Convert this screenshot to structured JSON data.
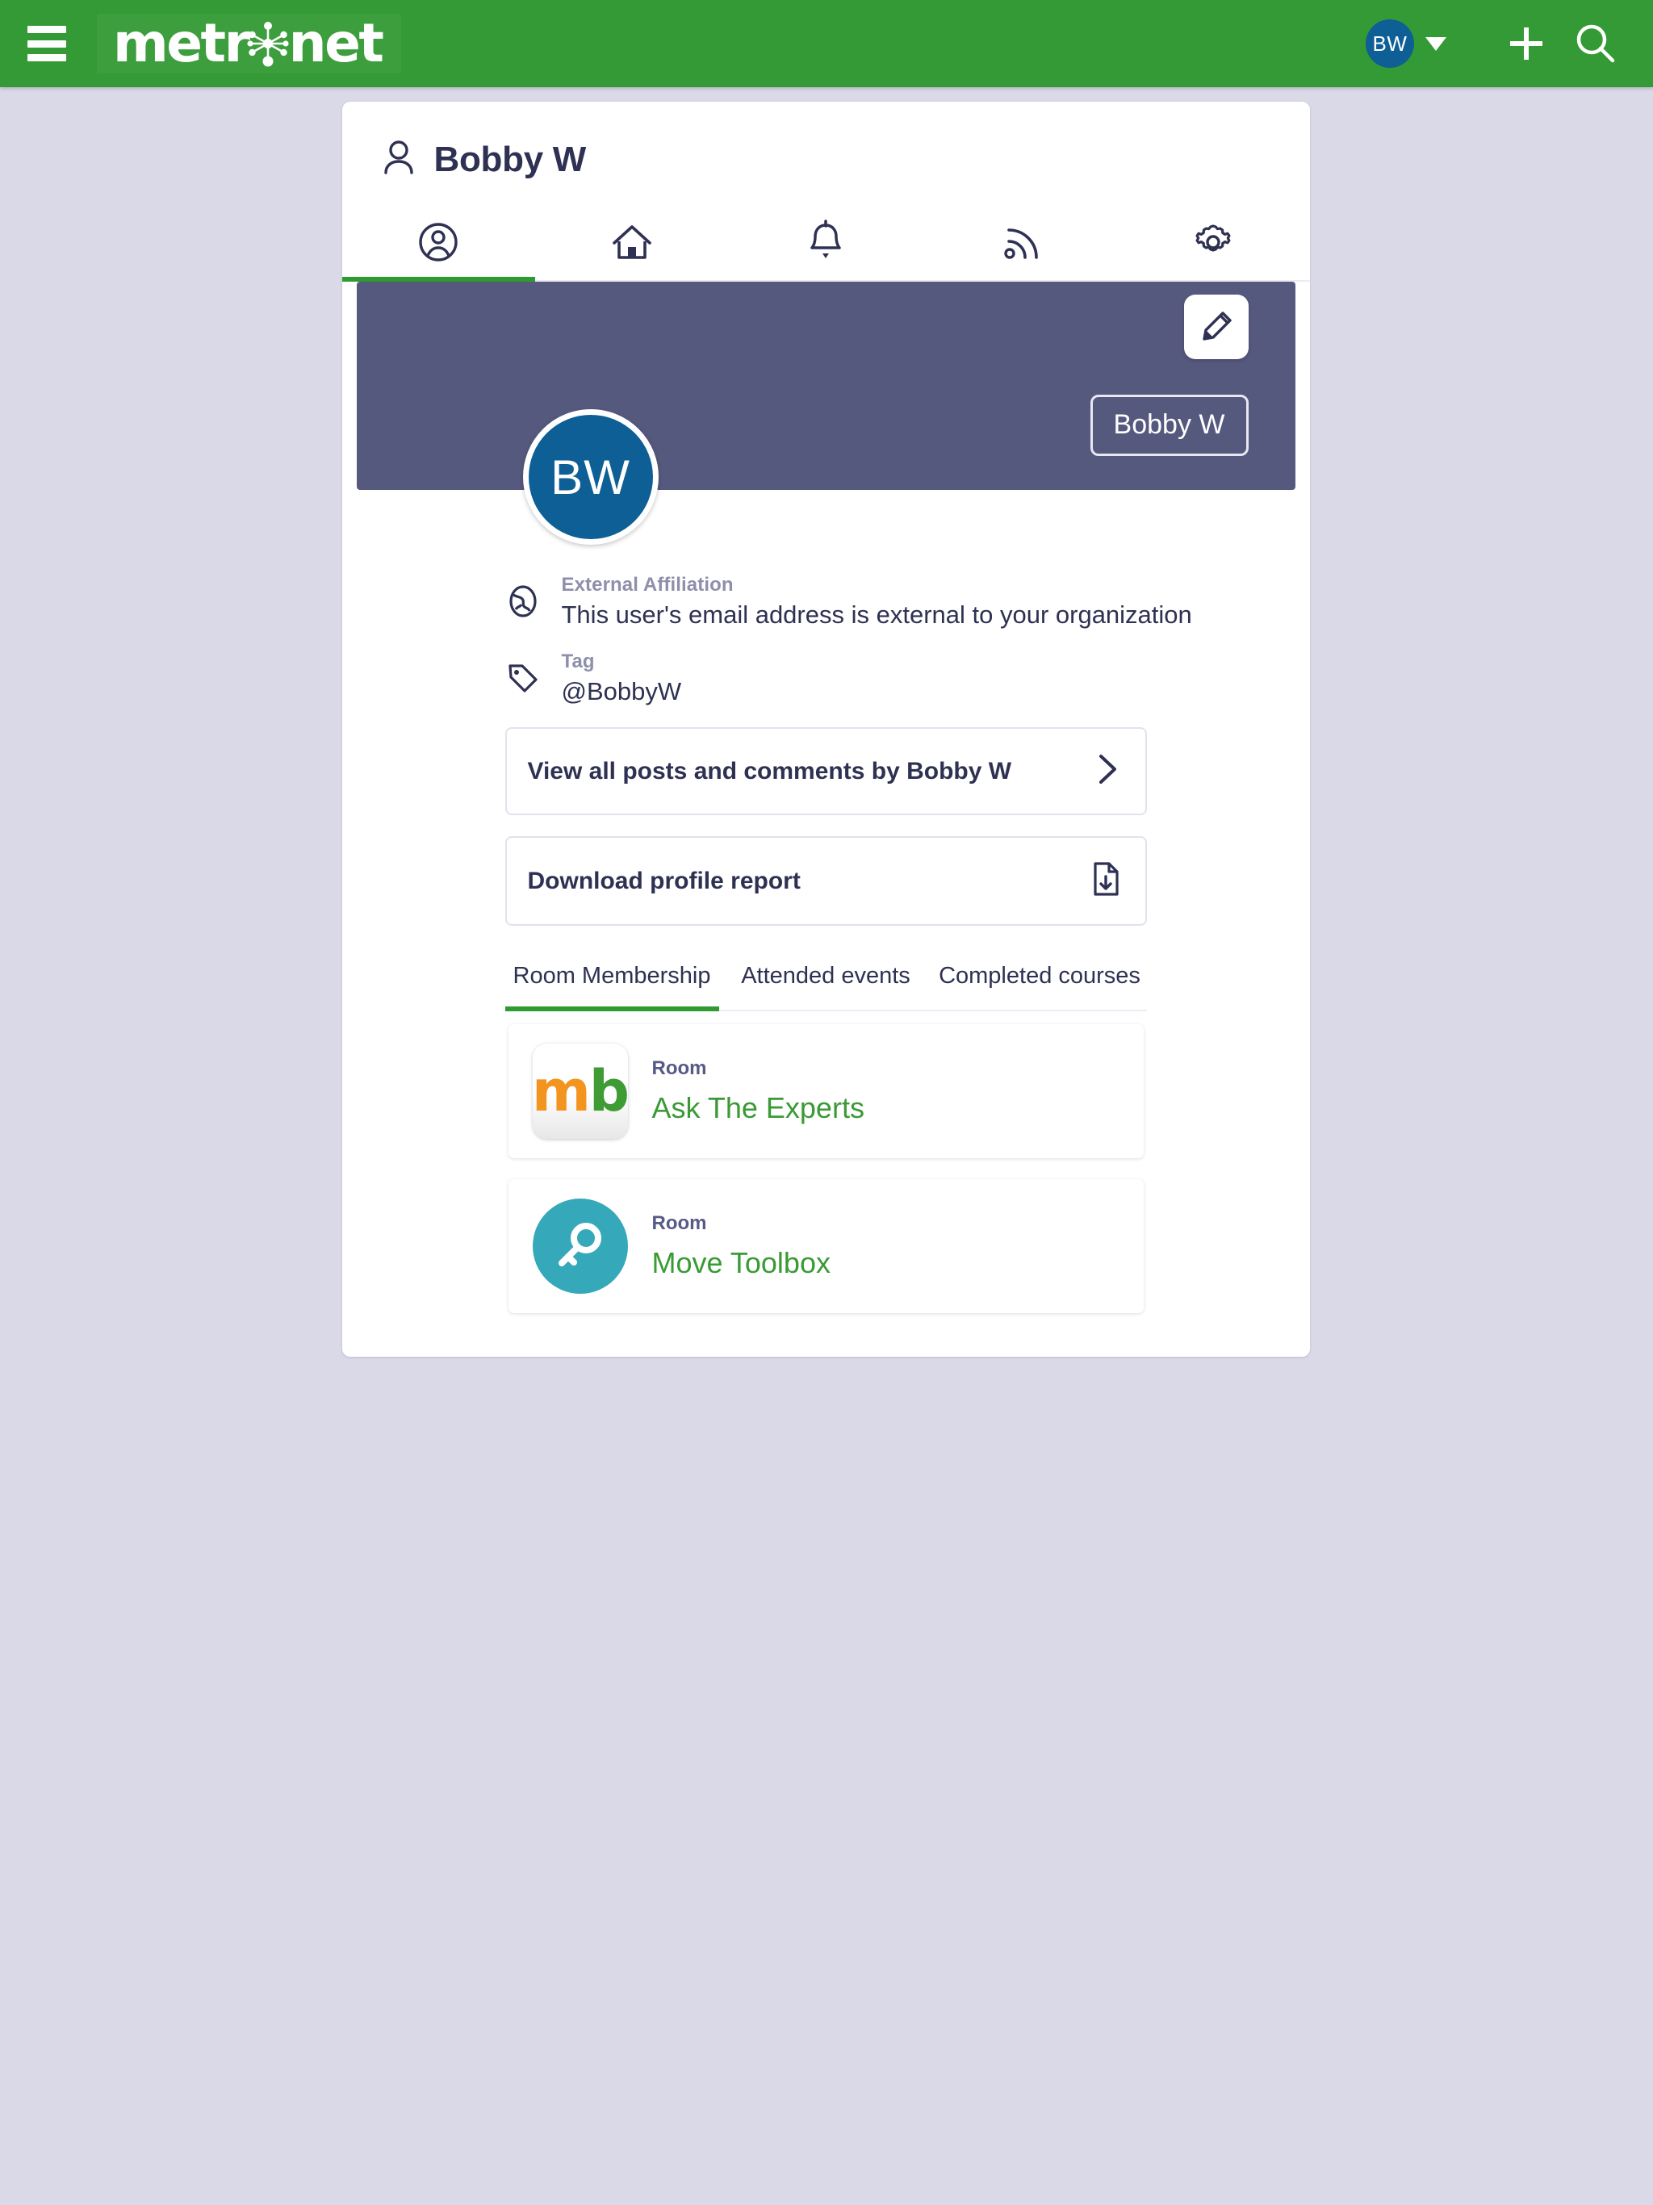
{
  "appbar": {
    "menu_label": "menu",
    "brand_part1": "metr",
    "brand_part2": "net",
    "user_initials": "BW",
    "add_label": "+",
    "search_label": "search"
  },
  "card": {
    "title": "Bobby W",
    "icon_tabs": [
      {
        "name": "profile",
        "active": true
      },
      {
        "name": "home",
        "active": false
      },
      {
        "name": "notifications",
        "active": false
      },
      {
        "name": "feed",
        "active": false
      },
      {
        "name": "settings",
        "active": false
      }
    ],
    "banner": {
      "edit_label": "Edit",
      "name_badge": "Bobby W",
      "avatar_initials": "BW"
    },
    "meta": [
      {
        "icon": "globe-icon",
        "label": "External Affiliation",
        "value": "This user's email address is external to your organization"
      },
      {
        "icon": "tag-icon",
        "label": "Tag",
        "value": "@BobbyW"
      }
    ],
    "actions": [
      {
        "label": "View all posts and comments by Bobby W",
        "icon": "chevron-right-icon"
      },
      {
        "label": "Download profile report",
        "icon": "file-download-icon"
      }
    ],
    "section_tabs": [
      {
        "label": "Room Membership",
        "active": true
      },
      {
        "label": "Attended events",
        "active": false
      },
      {
        "label": "Completed courses",
        "active": false
      }
    ],
    "rooms": [
      {
        "kicker": "Room",
        "name": "Ask The Experts",
        "thumb": "mb-logo",
        "mb_m": "m",
        "mb_b": "b"
      },
      {
        "kicker": "Room",
        "name": "Move Toolbox",
        "thumb": "key-icon"
      }
    ]
  },
  "colors": {
    "brand_green": "#349a35",
    "brand_orange": "#f2941e",
    "banner": "#56597e",
    "avatar_blue": "#0d5f96",
    "page_bg": "#d9d9e8",
    "accent_underline": "#2e9b30",
    "room_name": "#3a9a35",
    "key_tile": "#35a8b9"
  }
}
